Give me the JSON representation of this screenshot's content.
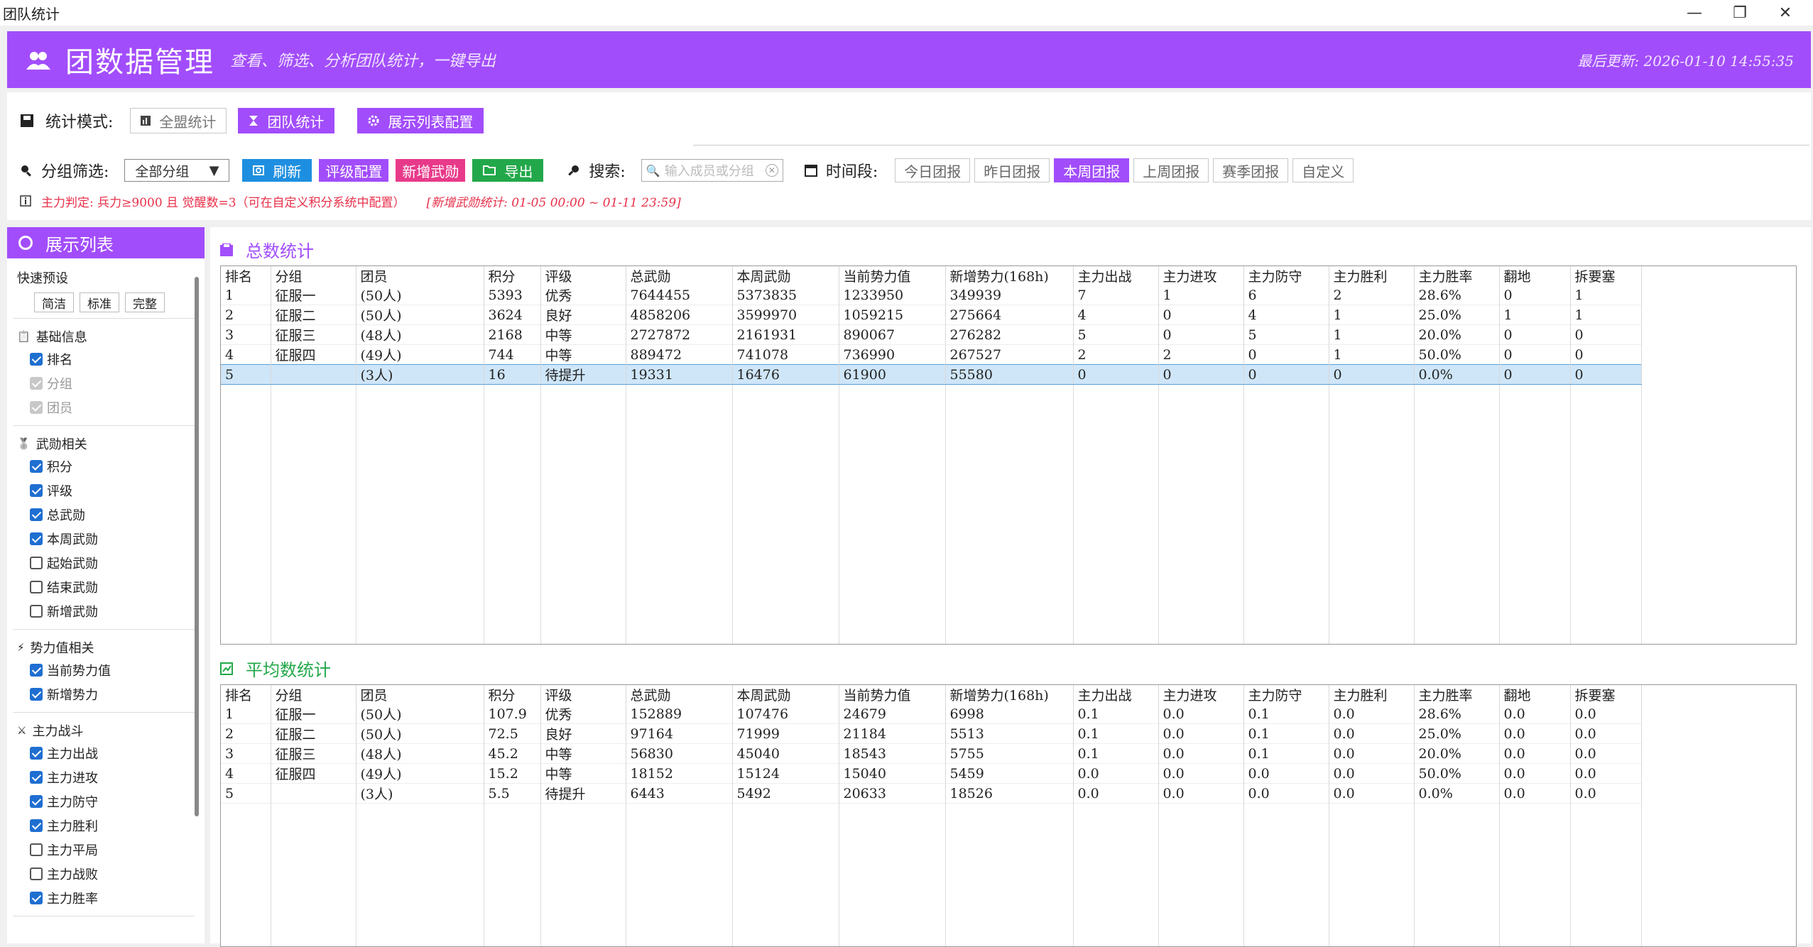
{
  "window": {
    "title": "团队统计",
    "controls": [
      "—",
      "❐",
      "✕"
    ]
  },
  "header": {
    "title": "团数据管理",
    "subtitle": "查看、筛选、分析团队统计，一键导出",
    "last_update": "最后更新: 2026-01-10 14:55:35"
  },
  "mode": {
    "label": "统计模式:",
    "buttons": [
      "全盟统计",
      "团队统计",
      "展示列表配置"
    ]
  },
  "filter": {
    "group_label": "分组筛选:",
    "group_value": "全部分组",
    "refresh": "刷新",
    "rating_config": "评级配置",
    "new_merit": "新增武勋",
    "export": "导出",
    "search_label": "搜索:",
    "search_placeholder": "输入成员或分组",
    "period_label": "时间段:",
    "periods": [
      "今日团报",
      "昨日团报",
      "本周团报",
      "上周团报",
      "赛季团报",
      "自定义"
    ],
    "active_period": 2
  },
  "hint": {
    "main": "主力判定: 兵力≥9000 且 觉醒数=3（可在自定义积分系统中配置）",
    "range": "[新增武勋统计: 01-05 00:00 ~ 01-11 23:59]"
  },
  "sidebar": {
    "title": "展示列表",
    "preset_label": "快速预设",
    "presets": [
      "简洁",
      "标准",
      "完整"
    ],
    "groups": [
      {
        "title": "基础信息",
        "icon": "clipboard-icon",
        "items": [
          {
            "label": "排名",
            "state": "on"
          },
          {
            "label": "分组",
            "state": "disabled"
          },
          {
            "label": "团员",
            "state": "disabled"
          }
        ]
      },
      {
        "title": "武勋相关",
        "icon": "medal-icon",
        "items": [
          {
            "label": "积分",
            "state": "on"
          },
          {
            "label": "评级",
            "state": "on"
          },
          {
            "label": "总武勋",
            "state": "on"
          },
          {
            "label": "本周武勋",
            "state": "on"
          },
          {
            "label": "起始武勋",
            "state": "off"
          },
          {
            "label": "结束武勋",
            "state": "off"
          },
          {
            "label": "新增武勋",
            "state": "off"
          }
        ]
      },
      {
        "title": "势力值相关",
        "icon": "lightning-icon",
        "items": [
          {
            "label": "当前势力值",
            "state": "on"
          },
          {
            "label": "新增势力",
            "state": "on"
          }
        ]
      },
      {
        "title": "主力战斗",
        "icon": "swords-icon",
        "items": [
          {
            "label": "主力出战",
            "state": "on"
          },
          {
            "label": "主力进攻",
            "state": "on"
          },
          {
            "label": "主力防守",
            "state": "on"
          },
          {
            "label": "主力胜利",
            "state": "on"
          },
          {
            "label": "主力平局",
            "state": "off"
          },
          {
            "label": "主力战败",
            "state": "off"
          },
          {
            "label": "主力胜率",
            "state": "on"
          }
        ]
      }
    ]
  },
  "columns": [
    "排名",
    "分组",
    "团员",
    "积分",
    "评级",
    "总武勋",
    "本周武勋",
    "当前势力值",
    "新增势力(168h)",
    "主力出战",
    "主力进攻",
    "主力防守",
    "主力胜利",
    "主力胜率",
    "翻地",
    "拆要塞"
  ],
  "total": {
    "title": "总数统计",
    "rows": [
      [
        "1",
        "征服一",
        "(50人)",
        "5393",
        "优秀",
        "7644455",
        "5373835",
        "1233950",
        "349939",
        "7",
        "1",
        "6",
        "2",
        "28.6%",
        "0",
        "1"
      ],
      [
        "2",
        "征服二",
        "(50人)",
        "3624",
        "良好",
        "4858206",
        "3599970",
        "1059215",
        "275664",
        "4",
        "0",
        "4",
        "1",
        "25.0%",
        "1",
        "1"
      ],
      [
        "3",
        "征服三",
        "(48人)",
        "2168",
        "中等",
        "2727872",
        "2161931",
        "890067",
        "276282",
        "5",
        "0",
        "5",
        "1",
        "20.0%",
        "0",
        "0"
      ],
      [
        "4",
        "征服四",
        "(49人)",
        "744",
        "中等",
        "889472",
        "741078",
        "736990",
        "267527",
        "2",
        "2",
        "0",
        "1",
        "50.0%",
        "0",
        "0"
      ],
      [
        "5",
        "",
        "(3人)",
        "16",
        "待提升",
        "19331",
        "16476",
        "61900",
        "55580",
        "0",
        "0",
        "0",
        "0",
        "0.0%",
        "0",
        "0"
      ]
    ]
  },
  "average": {
    "title": "平均数统计",
    "rows": [
      [
        "1",
        "征服一",
        "(50人)",
        "107.9",
        "优秀",
        "152889",
        "107476",
        "24679",
        "6998",
        "0.1",
        "0.0",
        "0.1",
        "0.0",
        "28.6%",
        "0.0",
        "0.0"
      ],
      [
        "2",
        "征服二",
        "(50人)",
        "72.5",
        "良好",
        "97164",
        "71999",
        "21184",
        "5513",
        "0.1",
        "0.0",
        "0.1",
        "0.0",
        "25.0%",
        "0.0",
        "0.0"
      ],
      [
        "3",
        "征服三",
        "(48人)",
        "45.2",
        "中等",
        "56830",
        "45040",
        "18543",
        "5755",
        "0.1",
        "0.0",
        "0.1",
        "0.0",
        "20.0%",
        "0.0",
        "0.0"
      ],
      [
        "4",
        "征服四",
        "(49人)",
        "15.2",
        "中等",
        "18152",
        "15124",
        "15040",
        "5459",
        "0.0",
        "0.0",
        "0.0",
        "0.0",
        "50.0%",
        "0.0",
        "0.0"
      ],
      [
        "5",
        "",
        "(3人)",
        "5.5",
        "待提升",
        "6443",
        "5492",
        "20633",
        "18526",
        "0.0",
        "0.0",
        "0.0",
        "0.0",
        "0.0%",
        "0.0",
        "0.0"
      ]
    ]
  },
  "colors": {
    "accent": "#a24dfb",
    "refresh": "#1e8fe0",
    "new_merit": "#e83a8a",
    "export": "#22a84a",
    "hint": "#e8304a",
    "section_total": "#a24dfb",
    "section_avg": "#22a84a",
    "highlight_row": "#cfe6f8"
  }
}
